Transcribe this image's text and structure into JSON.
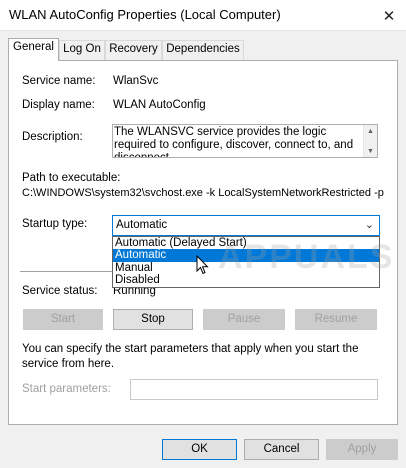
{
  "window": {
    "title": "WLAN AutoConfig Properties (Local Computer)",
    "close_glyph": "✕"
  },
  "tabs": [
    {
      "label": "General",
      "active": true
    },
    {
      "label": "Log On",
      "active": false
    },
    {
      "label": "Recovery",
      "active": false
    },
    {
      "label": "Dependencies",
      "active": false
    }
  ],
  "general": {
    "service_name_label": "Service name:",
    "service_name": "WlanSvc",
    "display_name_label": "Display name:",
    "display_name": "WLAN AutoConfig",
    "description_label": "Description:",
    "description": "The WLANSVC service provides the logic required to configure, discover, connect to, and disconnect",
    "path_label": "Path to executable:",
    "path": "C:\\WINDOWS\\system32\\svchost.exe -k LocalSystemNetworkRestricted -p",
    "startup_type_label": "Startup type:",
    "startup_type_value": "Automatic",
    "startup_options": [
      "Automatic (Delayed Start)",
      "Automatic",
      "Manual",
      "Disabled"
    ],
    "startup_selected_index": 1,
    "service_status_label": "Service status:",
    "service_status": "Running",
    "start_button": "Start",
    "stop_button": "Stop",
    "pause_button": "Pause",
    "resume_button": "Resume",
    "start_params_hint": "You can specify the start parameters that apply when you start the service from here.",
    "start_params_label": "Start parameters:",
    "start_params_value": ""
  },
  "footer": {
    "ok": "OK",
    "cancel": "Cancel",
    "apply": "Apply"
  },
  "watermark": "APPUALS",
  "colors": {
    "accent": "#0078d7",
    "disabled_text": "#a0a0a0"
  }
}
